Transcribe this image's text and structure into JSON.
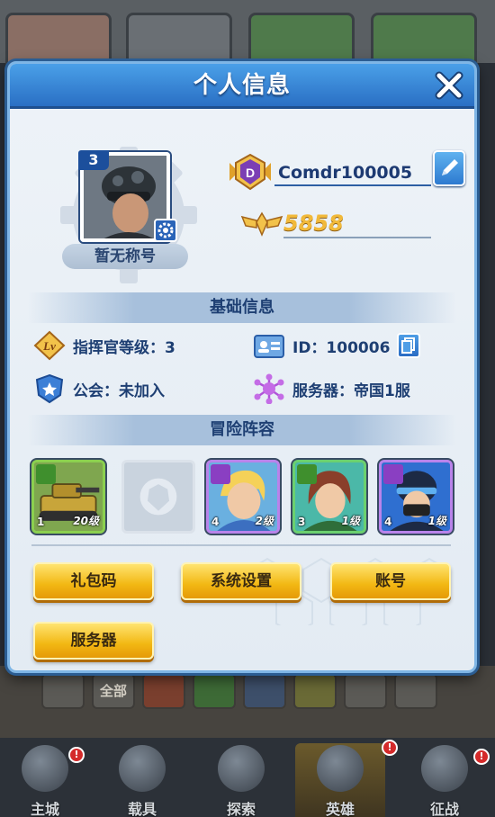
{
  "window": {
    "title": "个人信息"
  },
  "profile": {
    "avatar_level": "3",
    "title_tag": "暂无称号",
    "player_name": "Comdr100005",
    "rank_badge_letter": "D",
    "combat_power": "5858"
  },
  "basic_info": {
    "header": "基础信息",
    "commander_level": "指挥官等级：3",
    "player_id": "ID：100006",
    "guild": "公会：未加入",
    "server": "服务器：帝国1服"
  },
  "lineup": {
    "header": "冒险阵容",
    "heroes": [
      {
        "stars": "1",
        "level": "20级",
        "class_color": "#3f8f2d",
        "frame_color": "#5aa43b"
      },
      {
        "empty": true
      },
      {
        "stars": "4",
        "level": "2级",
        "class_color": "#8a3fc2",
        "frame_color": "#9b57d6"
      },
      {
        "stars": "3",
        "level": "1级",
        "class_color": "#3f8f2d",
        "frame_color": "#43a84a"
      },
      {
        "stars": "4",
        "level": "1级",
        "class_color": "#8a3fc2",
        "frame_color": "#9b57d6"
      }
    ]
  },
  "buttons": {
    "gift_code": "礼包码",
    "system_settings": "系统设置",
    "account": "账号",
    "server": "服务器"
  },
  "background_filter": {
    "all_label": "全部"
  },
  "bottom_nav": [
    {
      "label": "主城"
    },
    {
      "label": "载具"
    },
    {
      "label": "探索"
    },
    {
      "label": "英雄"
    },
    {
      "label": "征战"
    }
  ],
  "colors": {
    "accent_blue": "#2a6fc4",
    "button_gold": "#f2b713",
    "power_gold": "#f1b93a",
    "badge_red": "#d42a2a"
  },
  "icons": {
    "close": "close-icon",
    "edit": "edit-icon",
    "rank": "rank-badge-icon",
    "power": "wings-icon",
    "level": "lv-icon",
    "id": "id-card-icon",
    "copy": "copy-icon",
    "guild": "shield-star-icon",
    "server": "network-icon"
  }
}
